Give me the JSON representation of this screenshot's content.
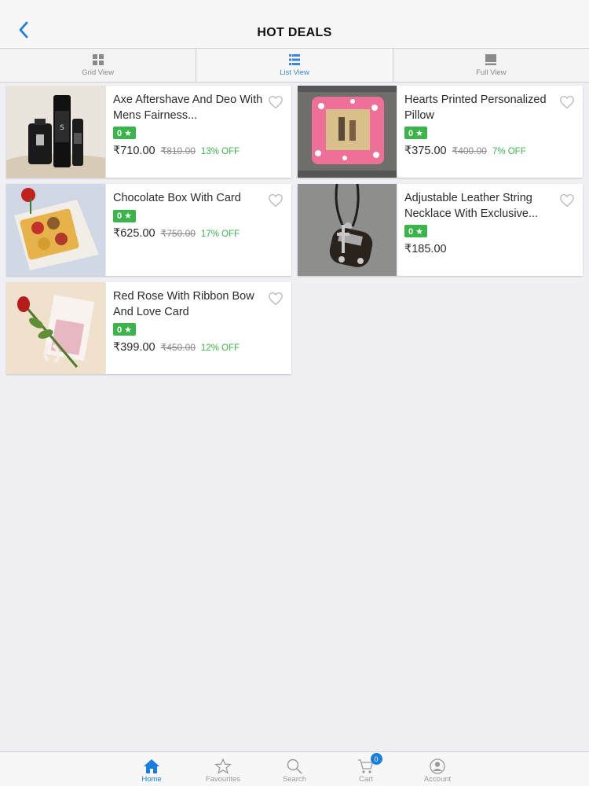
{
  "header": {
    "title": "HOT DEALS"
  },
  "view_toggle": [
    {
      "label": "Grid View",
      "icon": "grid-icon",
      "active": false
    },
    {
      "label": "List View",
      "icon": "list-icon",
      "active": true
    },
    {
      "label": "Full View",
      "icon": "full-view-icon",
      "active": false
    }
  ],
  "products": [
    {
      "name": "Axe Aftershave And Deo With Mens Fairness...",
      "rating": "0 ★",
      "price": "₹710.00",
      "mrp": "₹810.00",
      "off": "13% OFF"
    },
    {
      "name": "Hearts Printed Personalized Pillow",
      "rating": "0 ★",
      "price": "₹375.00",
      "mrp": "₹400.00",
      "off": "7% OFF"
    },
    {
      "name": "Chocolate Box With Card",
      "rating": "0 ★",
      "price": "₹625.00",
      "mrp": "₹750.00",
      "off": "17% OFF"
    },
    {
      "name": "Adjustable Leather String Necklace With Exclusive...",
      "rating": "0 ★",
      "price": "₹185.00",
      "mrp": "",
      "off": ""
    },
    {
      "name": "Red Rose With Ribbon Bow And Love Card",
      "rating": "0 ★",
      "price": "₹399.00",
      "mrp": "₹450.00",
      "off": "12% OFF"
    }
  ],
  "tabbar": [
    {
      "label": "Home",
      "icon": "home-icon",
      "active": true
    },
    {
      "label": "Favourites",
      "icon": "star-icon",
      "active": false
    },
    {
      "label": "Search",
      "icon": "search-icon",
      "active": false
    },
    {
      "label": "Cart",
      "icon": "cart-icon",
      "active": false,
      "badge": "0"
    },
    {
      "label": "Account",
      "icon": "account-icon",
      "active": false
    }
  ],
  "colors": {
    "accent": "#1a7ee0",
    "rating_green": "#3bb54a",
    "background": "#efeff4"
  }
}
